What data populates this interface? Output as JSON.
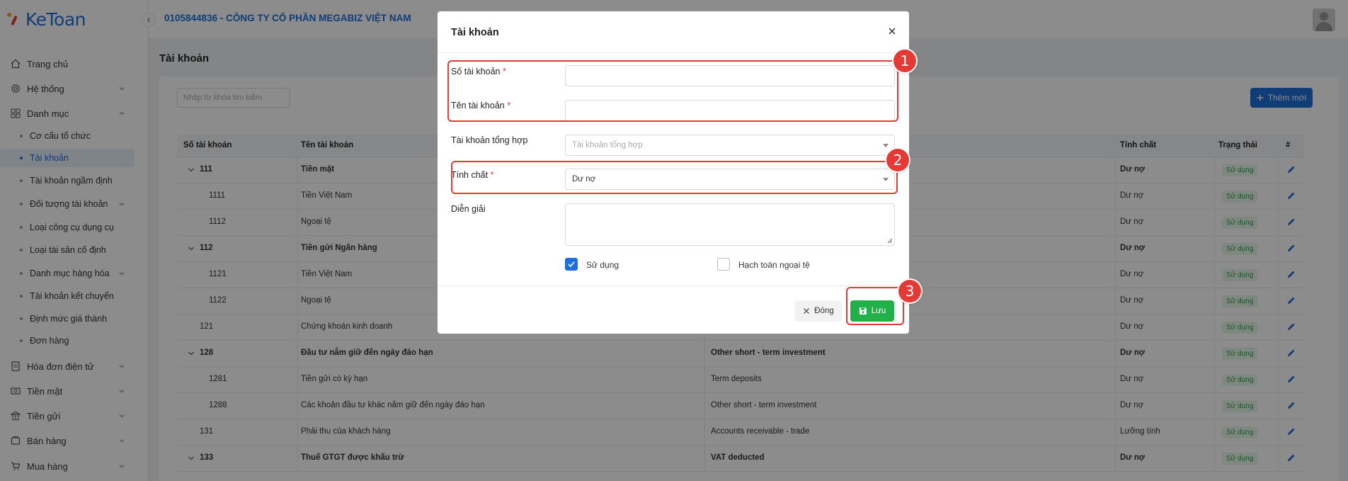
{
  "app": {
    "logo": "KeToan",
    "company": "0105844836 - CÔNG TY CỔ PHẦN MEGABIZ VIỆT NAM"
  },
  "sidebar": {
    "items": [
      {
        "label": "Trang chủ",
        "icon": "home-icon"
      },
      {
        "label": "Hệ thống",
        "icon": "gear-icon"
      },
      {
        "label": "Danh mục",
        "icon": "grid-icon"
      },
      {
        "label": "Hóa đơn điện tử",
        "icon": "invoice-icon"
      },
      {
        "label": "Tiền mặt",
        "icon": "cash-icon"
      },
      {
        "label": "Tiền gửi",
        "icon": "bank-icon"
      },
      {
        "label": "Bán hàng",
        "icon": "sales-icon"
      },
      {
        "label": "Mua hàng",
        "icon": "cart-icon"
      }
    ],
    "sub_items": [
      "Cơ cấu tổ chức",
      "Tài khoản",
      "Tài khoản ngầm định",
      "Đối tượng tài khoản",
      "Loại công cụ dụng cụ",
      "Loại tài sản cố định",
      "Danh mục hàng hóa",
      "Tài khoản kết chuyển",
      "Định mức giá thành",
      "Đơn hàng"
    ]
  },
  "page": {
    "title": "Tài khoản",
    "search_placeholder": "Nhập từ khóa tìm kiếm",
    "add_button": "Thêm mới"
  },
  "table": {
    "headers": [
      "Số tài khoản",
      "Tên tài khoản",
      "Tính chất",
      "Trạng thái",
      "#"
    ],
    "rows": [
      {
        "code": "111",
        "name": "Tiền mặt",
        "en": "",
        "nature": "Dư nợ",
        "status": "Sử dụng",
        "bold": true,
        "expand": true,
        "level": 0
      },
      {
        "code": "1111",
        "name": "Tiền Việt Nam",
        "en": "",
        "nature": "Dư nợ",
        "status": "Sử dụng",
        "bold": false,
        "expand": false,
        "level": 1
      },
      {
        "code": "1112",
        "name": "Ngoại tệ",
        "en": "",
        "nature": "Dư nợ",
        "status": "Sử dụng",
        "bold": false,
        "expand": false,
        "level": 1
      },
      {
        "code": "112",
        "name": "Tiền gửi Ngân hàng",
        "en": "",
        "nature": "Dư nợ",
        "status": "Sử dụng",
        "bold": true,
        "expand": true,
        "level": 0
      },
      {
        "code": "1121",
        "name": "Tiền Việt Nam",
        "en": "",
        "nature": "Dư nợ",
        "status": "Sử dụng",
        "bold": false,
        "expand": false,
        "level": 1
      },
      {
        "code": "1122",
        "name": "Ngoại tệ",
        "en": "",
        "nature": "Dư nợ",
        "status": "Sử dụng",
        "bold": false,
        "expand": false,
        "level": 1
      },
      {
        "code": "121",
        "name": "Chứng khoán kinh doanh",
        "en": "",
        "nature": "Dư nợ",
        "status": "Sử dụng",
        "bold": false,
        "expand": false,
        "level": 0
      },
      {
        "code": "128",
        "name": "Đầu tư nắm giữ đến ngày đáo hạn",
        "en": "Other short - term investment",
        "nature": "Dư nợ",
        "status": "Sử dụng",
        "bold": true,
        "expand": true,
        "level": 0
      },
      {
        "code": "1281",
        "name": "Tiền gửi có kỳ hạn",
        "en": "Term deposits",
        "nature": "Dư nợ",
        "status": "Sử dụng",
        "bold": false,
        "expand": false,
        "level": 1
      },
      {
        "code": "1288",
        "name": "Các khoản đầu tư khác nắm giữ đến ngày đáo hạn",
        "en": "Other short - term investment",
        "nature": "Dư nợ",
        "status": "Sử dụng",
        "bold": false,
        "expand": false,
        "level": 1
      },
      {
        "code": "131",
        "name": "Phải thu của khách hàng",
        "en": "Accounts receivable - trade",
        "nature": "Lưỡng tính",
        "status": "Sử dụng",
        "bold": false,
        "expand": false,
        "level": 0
      },
      {
        "code": "133",
        "name": "Thuế GTGT được khấu trừ",
        "en": "VAT deducted",
        "nature": "Dư nợ",
        "status": "Sử dụng",
        "bold": true,
        "expand": true,
        "level": 0
      }
    ]
  },
  "modal": {
    "title": "Tài khoản",
    "fields": {
      "account_no": {
        "label": "Số tài khoản",
        "value": ""
      },
      "account_name": {
        "label": "Tên tài khoản",
        "value": ""
      },
      "parent": {
        "label": "Tài khoản tổng hợp",
        "placeholder": "Tài khoản tổng hợp"
      },
      "nature": {
        "label": "Tính chất",
        "value": "Dư nợ"
      },
      "description": {
        "label": "Diễn giải",
        "value": ""
      }
    },
    "checkboxes": {
      "use": {
        "label": "Sử dụng",
        "checked": true
      },
      "foreign": {
        "label": "Hạch toán ngoại tệ",
        "checked": false
      }
    },
    "buttons": {
      "close": "Đóng",
      "save": "Lưu"
    }
  },
  "callouts": [
    "1",
    "2",
    "3"
  ],
  "colors": {
    "primary": "#1e6fd9",
    "success": "#22b04b",
    "callout": "#e53935"
  }
}
